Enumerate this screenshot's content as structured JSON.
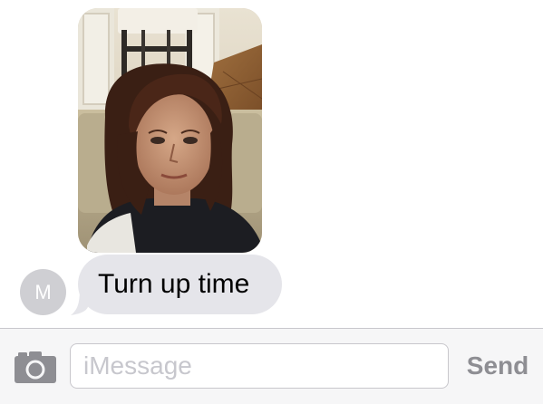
{
  "conversation": {
    "messages": [
      {
        "type": "image",
        "sender": "received",
        "icon": "photo-attachment"
      },
      {
        "type": "text",
        "sender": "received",
        "text": "Turn up time"
      }
    ],
    "contact_avatar_initial": "M"
  },
  "composer": {
    "placeholder": "iMessage",
    "value": "",
    "send_label": "Send",
    "camera_icon": "camera-icon"
  },
  "colors": {
    "received_bubble": "#e5e5ea",
    "avatar_bg": "#cfcfd3",
    "send_disabled": "#8e8e93",
    "camera_icon": "#8e8e93"
  }
}
